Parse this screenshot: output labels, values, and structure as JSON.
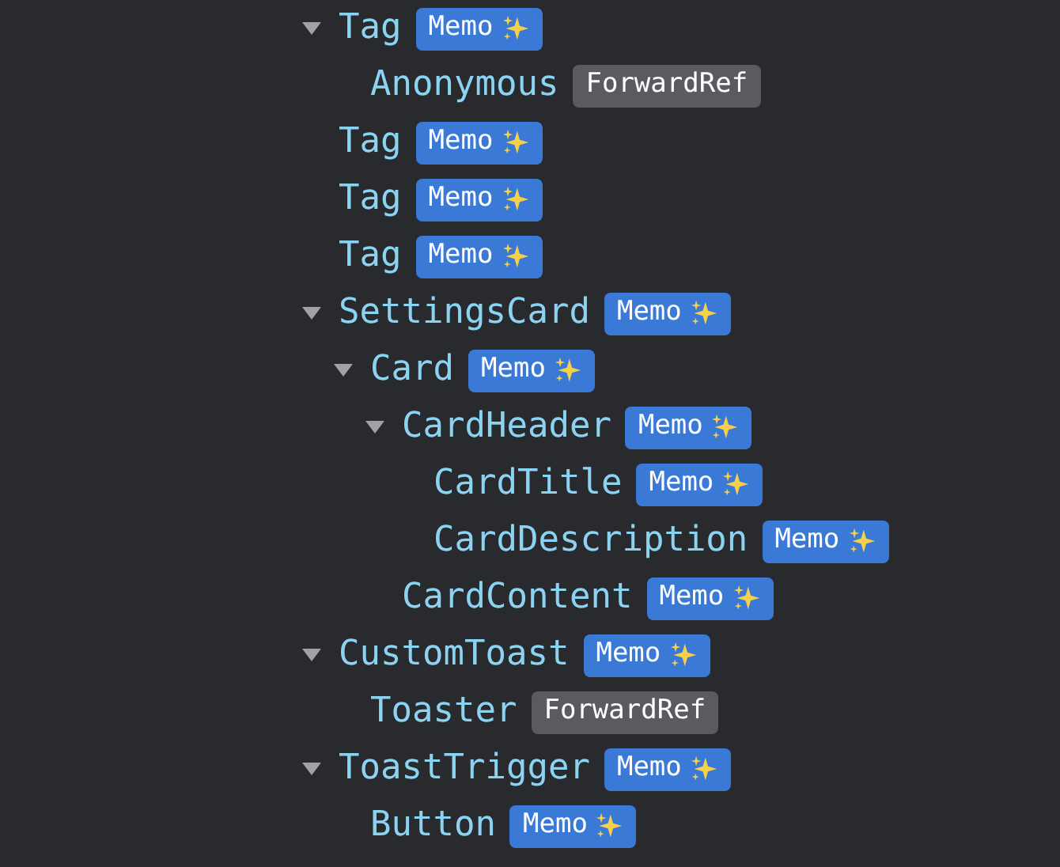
{
  "tree": [
    {
      "name": "Tag",
      "badge": {
        "label": "Memo",
        "kind": "memo"
      },
      "expanded": true,
      "children": [
        {
          "name": "Anonymous",
          "badge": {
            "label": "ForwardRef",
            "kind": "forwardref"
          }
        }
      ]
    },
    {
      "name": "Tag",
      "badge": {
        "label": "Memo",
        "kind": "memo"
      }
    },
    {
      "name": "Tag",
      "badge": {
        "label": "Memo",
        "kind": "memo"
      }
    },
    {
      "name": "Tag",
      "badge": {
        "label": "Memo",
        "kind": "memo"
      }
    },
    {
      "name": "SettingsCard",
      "badge": {
        "label": "Memo",
        "kind": "memo"
      },
      "expanded": true,
      "children": [
        {
          "name": "Card",
          "badge": {
            "label": "Memo",
            "kind": "memo"
          },
          "expanded": true,
          "children": [
            {
              "name": "CardHeader",
              "badge": {
                "label": "Memo",
                "kind": "memo"
              },
              "expanded": true,
              "children": [
                {
                  "name": "CardTitle",
                  "badge": {
                    "label": "Memo",
                    "kind": "memo"
                  }
                },
                {
                  "name": "CardDescription",
                  "badge": {
                    "label": "Memo",
                    "kind": "memo"
                  }
                }
              ]
            },
            {
              "name": "CardContent",
              "badge": {
                "label": "Memo",
                "kind": "memo"
              }
            }
          ]
        }
      ]
    },
    {
      "name": "CustomToast",
      "badge": {
        "label": "Memo",
        "kind": "memo"
      },
      "expanded": true,
      "children": [
        {
          "name": "Toaster",
          "badge": {
            "label": "ForwardRef",
            "kind": "forwardref"
          }
        }
      ]
    },
    {
      "name": "ToastTrigger",
      "badge": {
        "label": "Memo",
        "kind": "memo"
      },
      "expanded": true,
      "children": [
        {
          "name": "Button",
          "badge": {
            "label": "Memo",
            "kind": "memo"
          }
        }
      ]
    }
  ]
}
